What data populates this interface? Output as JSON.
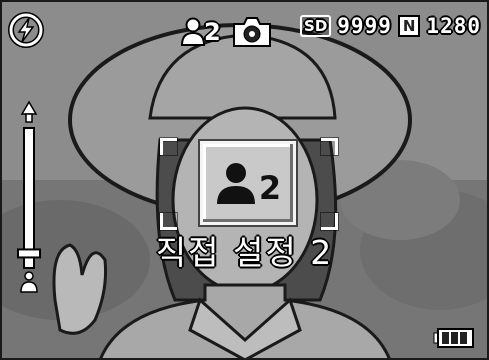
{
  "scene_mode": {
    "icon": "person-icon",
    "number": "2",
    "label": "직접 설정 2"
  },
  "status_bar": {
    "media_icon": "sd-card-icon",
    "media_label": "SD",
    "shots_remaining": "9999",
    "quality_label": "N",
    "resolution": "1280"
  },
  "icons": {
    "flash": "auto-flash-icon",
    "camera": "camera-icon",
    "battery": "battery-icon",
    "zoom_tele": "zoom-tele-icon",
    "zoom_wide": "zoom-wide-icon"
  },
  "zoom": {
    "level": 0.08
  },
  "colors": {
    "osd_text": "#ffffff",
    "osd_outline": "#000000",
    "mode_box_bg": "#c9c9c9"
  }
}
